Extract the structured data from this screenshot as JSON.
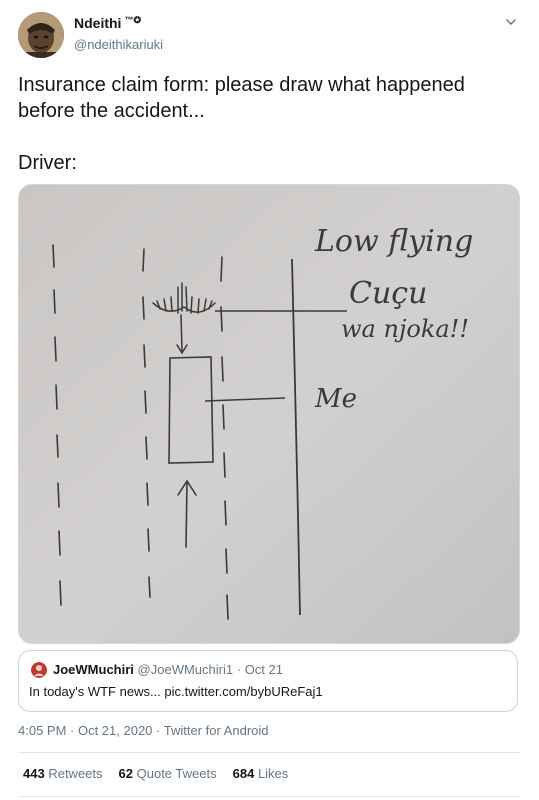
{
  "author": {
    "display_name": "Ndeithi",
    "name_suffix": "™✪",
    "handle": "@ndeithikariuki",
    "avatar": "avatar-photo"
  },
  "tweet": {
    "text": "Insurance claim form: please draw what happened before the accident...\n\nDriver:"
  },
  "media": {
    "handwriting": {
      "line1": "Low flying",
      "line2": "Cuçu",
      "line3": "wa njoka!!",
      "label_me": "Me"
    }
  },
  "quote": {
    "name": "JoeWMuchiri",
    "handle": "@JoeWMuchiri1",
    "separator": "·",
    "date": "Oct 21",
    "text": "In today's WTF news... pic.twitter.com/bybUReFaj1"
  },
  "meta": {
    "timestamp": "4:05 PM · Oct 21, 2020 · Twitter for Android"
  },
  "stats": {
    "retweets_count": "443",
    "retweets_label": "Retweets",
    "quotes_count": "62",
    "quotes_label": "Quote Tweets",
    "likes_count": "684",
    "likes_label": "Likes"
  },
  "icons": {
    "menu": "chevron-down-icon"
  }
}
